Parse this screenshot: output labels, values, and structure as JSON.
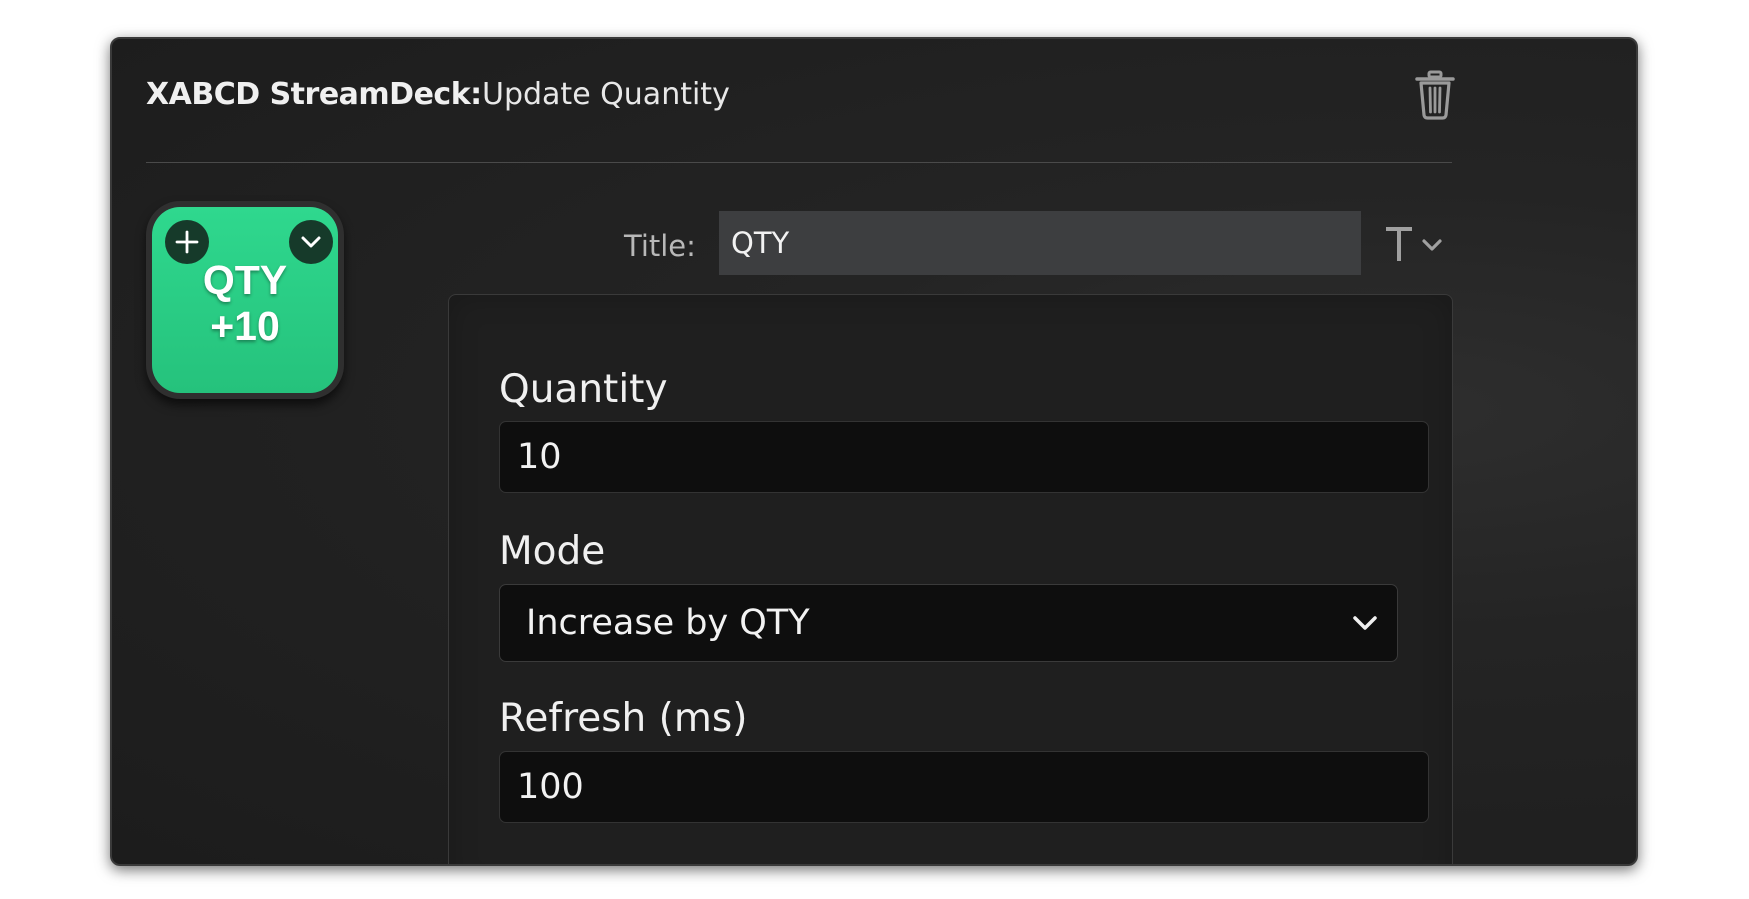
{
  "header": {
    "plugin_name": "XABCD StreamDeck:",
    "action_name": "Update Quantity",
    "delete_icon": "trash-icon"
  },
  "key_preview": {
    "line1": "QTY",
    "line2": "+10",
    "background_color": "#2fd88e",
    "add_icon": "plus-icon",
    "state_icon": "chevron-down-icon"
  },
  "title_field": {
    "label": "Title:",
    "value": "QTY",
    "format_icon": "text-format-icon"
  },
  "settings": {
    "quantity": {
      "label": "Quantity",
      "value": "10"
    },
    "mode": {
      "label": "Mode",
      "selected": "Increase by QTY"
    },
    "refresh": {
      "label": "Refresh (ms)",
      "value": "100"
    }
  }
}
